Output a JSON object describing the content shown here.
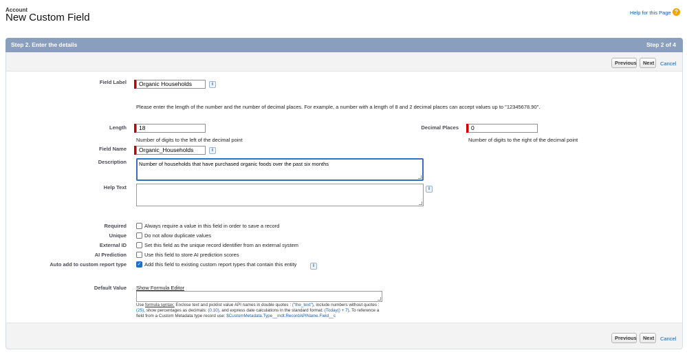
{
  "header": {
    "object_name": "Account",
    "title": "New Custom Field",
    "help_link": "Help for this Page",
    "help_icon": "?"
  },
  "panel": {
    "step_title": "Step 2. Enter the details",
    "step_number": "Step 2 of 4"
  },
  "buttons": {
    "previous": "Previous",
    "next": "Next",
    "cancel": "Cancel"
  },
  "form": {
    "field_label": {
      "label": "Field Label",
      "value": "Organic Households"
    },
    "length_note": "Please enter the length of the number and the number of decimal places. For example, a number with a length of 8 and 2 decimal places can accept values up to \"12345678.90\".",
    "length": {
      "label": "Length",
      "value": "18",
      "hint": "Number of digits to the left of the decimal point"
    },
    "decimal_places": {
      "label": "Decimal Places",
      "value": "0",
      "hint": "Number of digits to the right of the decimal point"
    },
    "field_name": {
      "label": "Field Name",
      "value": "Organic_Households"
    },
    "description": {
      "label": "Description",
      "value": "Number of households that have purchased organic foods over the past six months"
    },
    "help_text": {
      "label": "Help Text",
      "value": ""
    },
    "required": {
      "label": "Required",
      "text": "Always require a value in this field in order to save a record",
      "checked": false
    },
    "unique": {
      "label": "Unique",
      "text": "Do not allow duplicate values",
      "checked": false
    },
    "external_id": {
      "label": "External ID",
      "text": "Set this field as the unique record identifier from an external system",
      "checked": false
    },
    "ai_prediction": {
      "label": "AI Prediction",
      "text": "Use this field to store AI prediction scores",
      "checked": false
    },
    "auto_add": {
      "label": "Auto add to custom report type",
      "text": "Add this field to existing custom report types that contain this entity",
      "checked": true
    },
    "default_value": {
      "label": "Default Value",
      "formula_link": "Show Formula Editor",
      "value": "",
      "hint_use": "Use ",
      "hint_syntax": "formula syntax:",
      "hint_1": " Enclose text and picklist value API names in double quotes : ",
      "hint_ex1": "(\"the_text\")",
      "hint_2": ", include numbers without quotes : ",
      "hint_ex2": "(25)",
      "hint_3": ", show percentages as decimals: ",
      "hint_ex3": "(0.10)",
      "hint_4": ", and express date calculations in the standard format: ",
      "hint_ex4": "(Today() + 7)",
      "hint_5": ". To reference a field from a Custom Metadata type record use: ",
      "hint_ex5": "$CustomMetadata.Type__mdt.RecordAPIName.Field__c"
    }
  },
  "colors": {
    "header_bar": "#8a9ebe",
    "required_marker": "#cc0000",
    "link": "#1a5ea6",
    "focus": "#2f6fc4"
  }
}
